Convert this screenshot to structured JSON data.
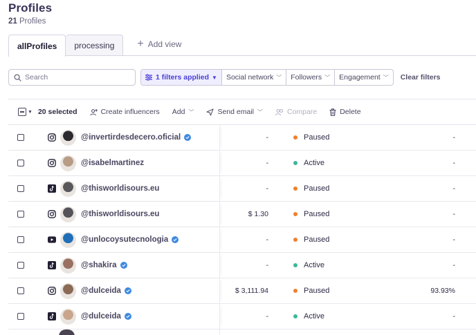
{
  "header": {
    "title": "Profiles",
    "count": "21",
    "count_label": "Profiles"
  },
  "tabs": [
    {
      "label": "allProfiles",
      "active": true
    },
    {
      "label": "processing",
      "active": false
    }
  ],
  "add_view_label": "Add view",
  "search": {
    "placeholder": "Search",
    "value": ""
  },
  "filters": {
    "applied_label": "1 filters applied",
    "items": [
      "Social network",
      "Followers",
      "Engagement"
    ],
    "clear_label": "Clear filters"
  },
  "toolbar": {
    "selected_label": "20 selected",
    "create_label": "Create influencers",
    "add_label": "Add",
    "send_email_label": "Send email",
    "compare_label": "Compare",
    "delete_label": "Delete"
  },
  "colors": {
    "accent": "#4b3fd6",
    "paused": "#f0802e",
    "active": "#3fb59a",
    "verified": "#3f8ae0",
    "instagram": "#231f33",
    "tiktok": "#231f33",
    "youtube": "#231f33"
  },
  "rows": [
    {
      "network": "instagram-icon",
      "handle": "@invertirdesdecero.oficial",
      "verified": true,
      "cost": "-",
      "status": "Paused",
      "engagement": "-",
      "avatar_color": "#2b2a2e"
    },
    {
      "network": "instagram-icon",
      "handle": "@isabelmartinez",
      "verified": false,
      "cost": "-",
      "status": "Active",
      "engagement": "-",
      "avatar_color": "#b79c86"
    },
    {
      "network": "tiktok-icon",
      "handle": "@thisworldisours.eu",
      "verified": false,
      "cost": "-",
      "status": "Paused",
      "engagement": "-",
      "avatar_color": "#5b585c"
    },
    {
      "network": "instagram-icon",
      "handle": "@thisworldisours.eu",
      "verified": false,
      "cost": "$ 1.30",
      "status": "Paused",
      "engagement": "-",
      "avatar_color": "#56545a"
    },
    {
      "network": "youtube-icon",
      "handle": "@unlocoysutecnologia",
      "verified": true,
      "cost": "-",
      "status": "Paused",
      "engagement": "-",
      "avatar_color": "#1f6fb8"
    },
    {
      "network": "tiktok-icon",
      "handle": "@shakira",
      "verified": true,
      "cost": "-",
      "status": "Active",
      "engagement": "-",
      "avatar_color": "#9a7063"
    },
    {
      "network": "instagram-icon",
      "handle": "@dulceida",
      "verified": true,
      "cost": "$ 3,111.94",
      "status": "Paused",
      "engagement": "93.93%",
      "avatar_color": "#8a6a55"
    },
    {
      "network": "tiktok-icon",
      "handle": "@dulceida",
      "verified": true,
      "cost": "-",
      "status": "Active",
      "engagement": "-",
      "avatar_color": "#c9a58e"
    }
  ]
}
